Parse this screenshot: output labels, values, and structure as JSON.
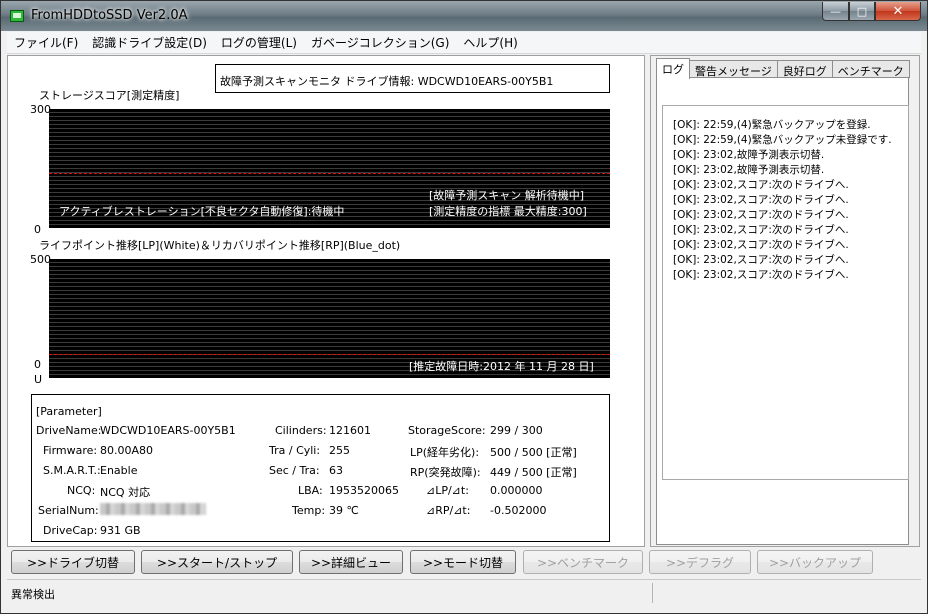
{
  "window": {
    "title": "FromHDDtoSSD Ver2.0A",
    "controls": {
      "minimize": "—",
      "maximize": "□",
      "close": "✕"
    }
  },
  "menu": [
    "ファイル(F)",
    "認識ドライブ設定(D)",
    "ログの管理(L)",
    "ガベージコレクション(G)",
    "ヘルプ(H)"
  ],
  "info_box": "故障予測スキャンモニタ ドライブ情報: WDCWD10EARS-00Y5B1",
  "storage_graph": {
    "title": "ストレージスコア[測定精度]",
    "y_max": "300",
    "y_min": "0",
    "status_left": "アクティブレストレーション[不良セクタ自動修復]:待機中",
    "status_right_1": "[故障予測スキャン 解析待機中]",
    "status_right_2": "[測定精度の指標 最大精度:300]"
  },
  "life_graph": {
    "title": "ライフポイント推移[LP](White)＆リカバリポイント推移[RP](Blue_dot)",
    "y_max": "500",
    "y_min": "0",
    "y_unit": "U",
    "predicted": "[推定故障日時:2012 年 11 月 28 日]"
  },
  "parameters": {
    "header": "[Parameter]",
    "drive_name_label": "DriveName:",
    "drive_name": "WDCWD10EARS-00Y5B1",
    "firmware_label": "Firmware:",
    "firmware": "80.00A80",
    "smart_label": "S.M.A.R.T.:",
    "smart": "Enable",
    "ncq_label": "NCQ:",
    "ncq": "NCQ 対応",
    "serial_label": "SerialNum:",
    "drivecap_label": "DriveCap:",
    "drivecap": "931 GB",
    "cilinders_label": "Cilinders:",
    "cilinders": "121601",
    "tra_cyli_label": "Tra / Cyli:",
    "tra_cyli": "255",
    "sec_tra_label": "Sec / Tra:",
    "sec_tra": "63",
    "lba_label": "LBA:",
    "lba": "1953520065",
    "temp_label": "Temp:",
    "temp": "39 ℃",
    "storage_score_label": "StorageScore:",
    "storage_score": "299 / 300",
    "lp_label": "LP(経年劣化):",
    "lp": "500 / 500 [正常]",
    "rp_label": "RP(突発故障):",
    "rp": "449 / 500 [正常]",
    "dlp_label": "⊿LP/⊿t:",
    "dlp": "0.000000",
    "drp_label": "⊿RP/⊿t:",
    "drp": "-0.502000"
  },
  "tabs": [
    "ログ",
    "警告メッセージ",
    "良好ログ",
    "ベンチマーク"
  ],
  "log_lines": [
    "[OK]: 22:59,(4)緊急バックアップを登録.",
    "[OK]: 22:59,(4)緊急バックアップ未登録です.",
    "[OK]: 23:02,故障予測表示切替.",
    "[OK]: 23:02,故障予測表示切替.",
    "[OK]: 23:02,スコア:次のドライブへ.",
    "[OK]: 23:02,スコア:次のドライブへ.",
    "[OK]: 23:02,スコア:次のドライブへ.",
    "[OK]: 23:02,スコア:次のドライブへ.",
    "[OK]: 23:02,スコア:次のドライブへ.",
    "[OK]: 23:02,スコア:次のドライブへ.",
    "[OK]: 23:02,スコア:次のドライブへ."
  ],
  "buttons": {
    "drive_switch": ">>ドライブ切替",
    "start_stop": ">>スタート/ストップ",
    "detail_view": ">>詳細ビュー",
    "mode_switch": ">>モード切替",
    "benchmark": ">>ベンチマーク",
    "defrag": ">>デフラグ",
    "backup": ">>バックアップ"
  },
  "status": "異常検出",
  "colors": {
    "graph_bg": "#000000",
    "threshold_line": "#e01010",
    "window_bg": "#f0f0f0"
  }
}
